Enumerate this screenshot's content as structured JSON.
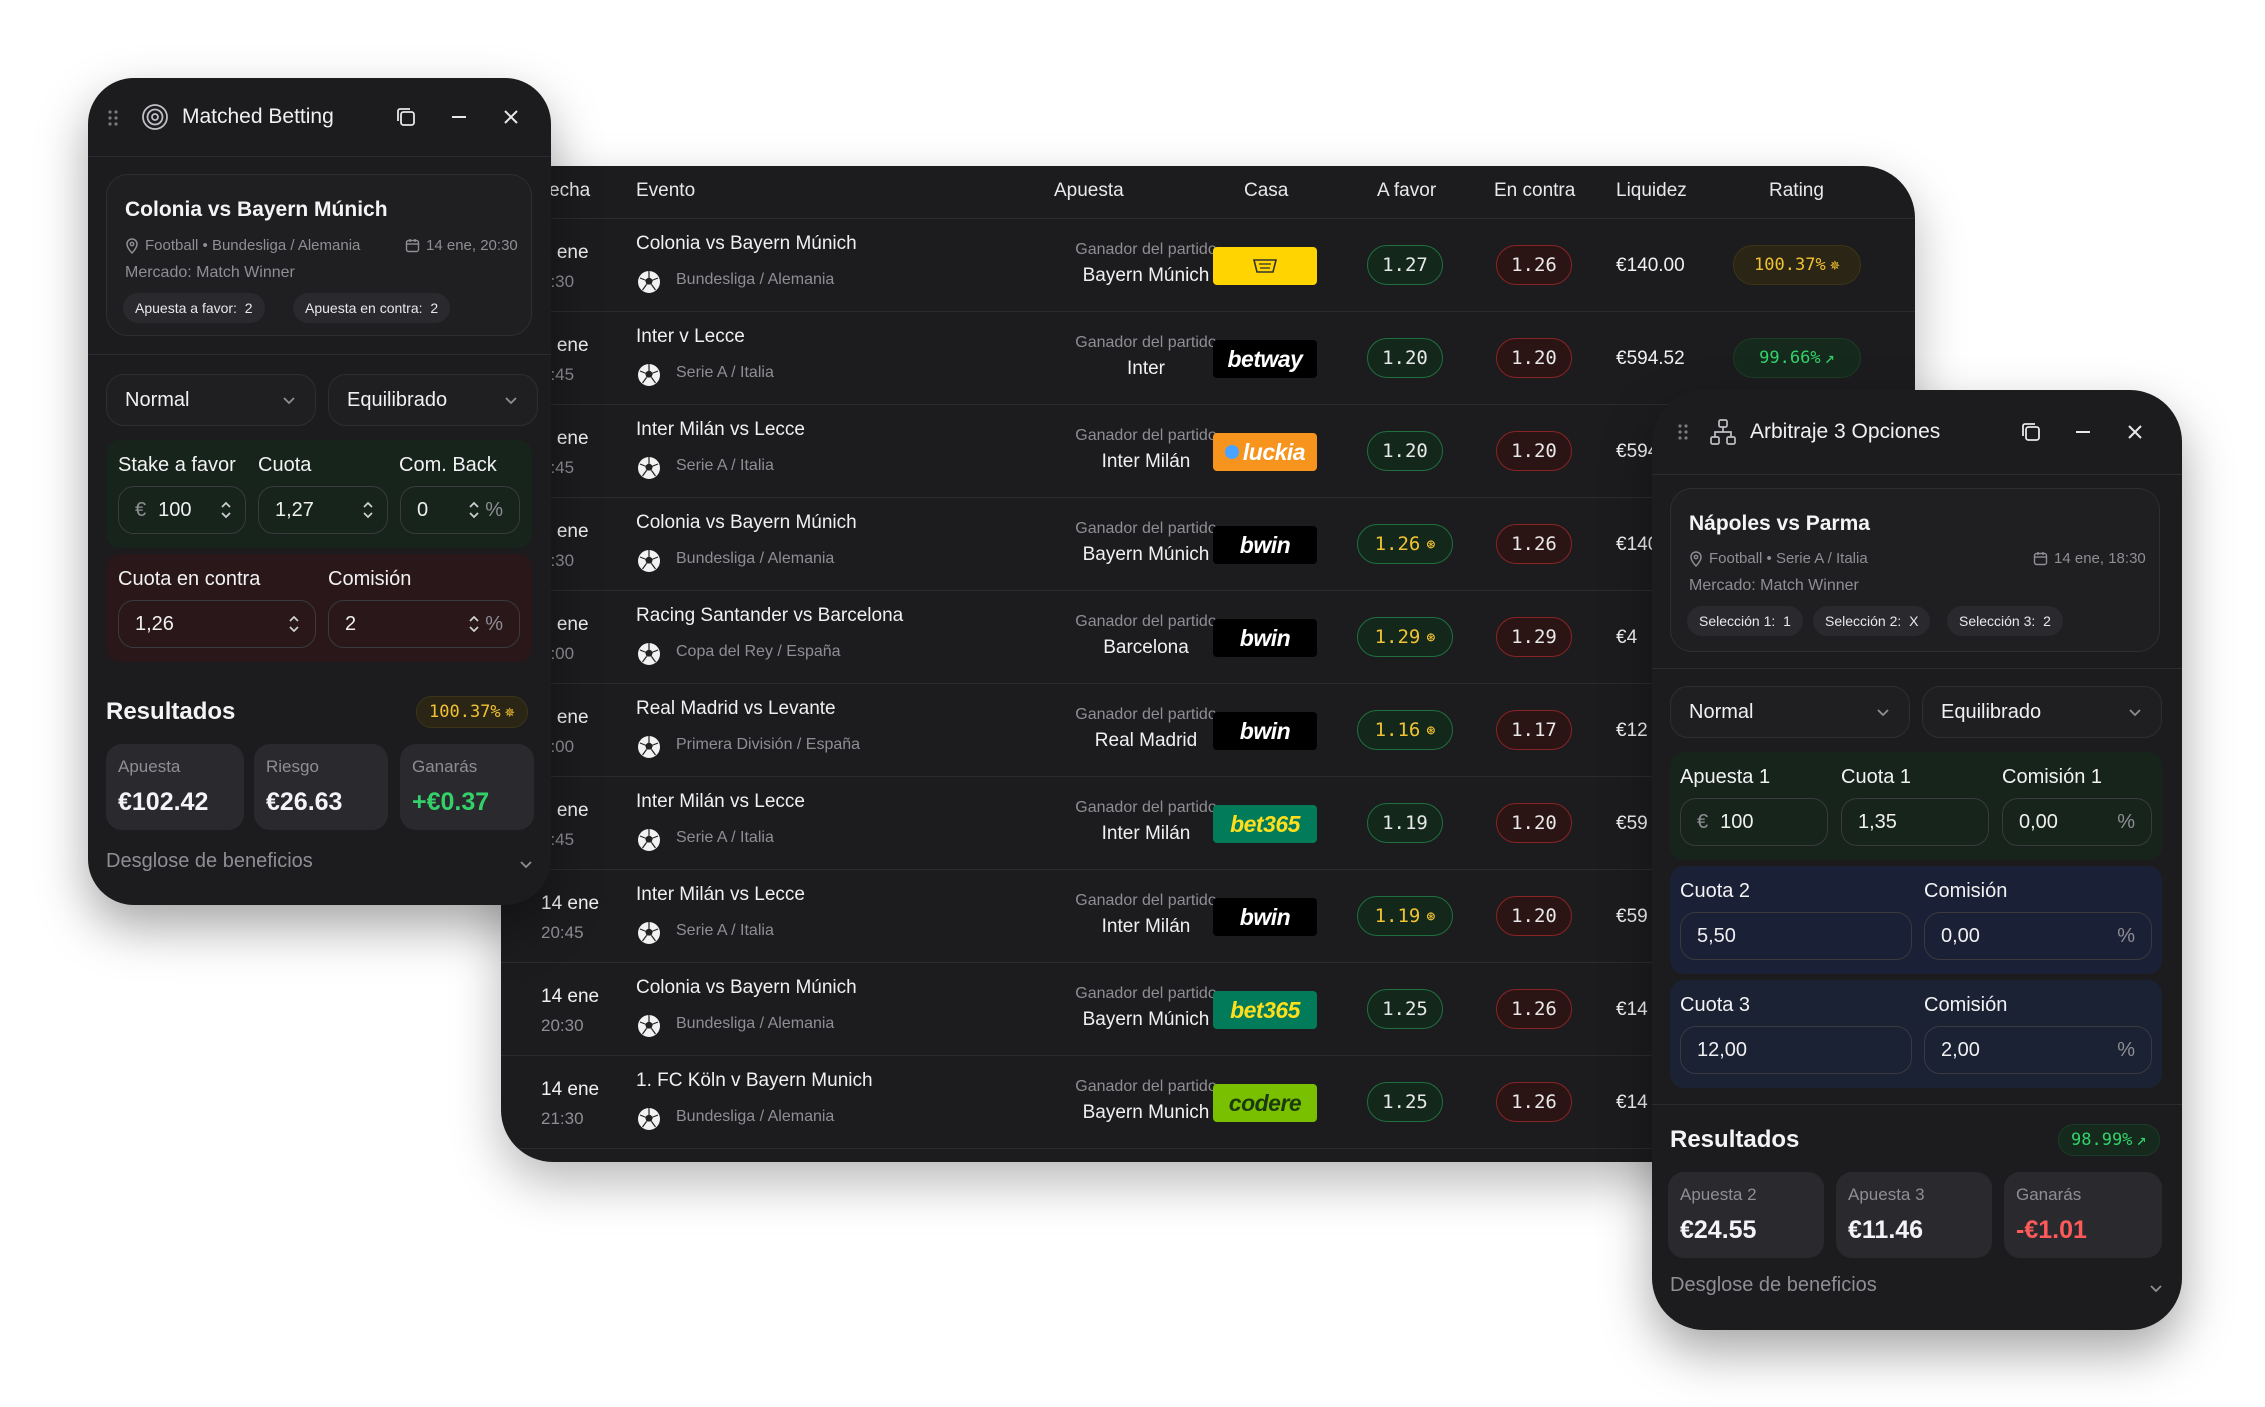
{
  "table": {
    "headers": {
      "date": "echa",
      "event": "Evento",
      "bet": "Apuesta",
      "house": "Casa",
      "back": "A favor",
      "lay": "En contra",
      "liquidity": "Liquidez",
      "rating": "Rating"
    },
    "rows": [
      {
        "date1": "4 ene",
        "date2": "0:30",
        "event": "Colonia vs Bayern Múnich",
        "league": "Bundesliga / Alemania",
        "bet_label": "Ganador del partido",
        "bet": "Bayern Múnich",
        "house": "interwetten",
        "back": "1.27",
        "lay": "1.26",
        "liquidity": "€140.00",
        "rating": "100.37%",
        "rating_icon": "sparkle-icon"
      },
      {
        "date1": "4 ene",
        "date2": "1:45",
        "event": "Inter v Lecce",
        "league": "Serie A / Italia",
        "bet_label": "Ganador del partido",
        "bet": "Inter",
        "house": "betway",
        "back": "1.20",
        "lay": "1.20",
        "liquidity": "€594.52",
        "rating": "99.66%",
        "rating_icon": "trend-up-icon"
      },
      {
        "date1": "4 ene",
        "date2": "0:45",
        "event": "Inter Milán vs Lecce",
        "league": "Serie A / Italia",
        "bet_label": "Ganador del partido",
        "bet": "Inter Milán",
        "house": "luckia",
        "back": "1.20",
        "lay": "1.20",
        "liquidity": "€594"
      },
      {
        "date1": "4 ene",
        "date2": "0:30",
        "event": "Colonia vs Bayern Múnich",
        "league": "Bundesliga / Alemania",
        "bet_label": "Ganador del partido",
        "bet": "Bayern Múnich",
        "house": "bwin",
        "back": "1.26",
        "lay": "1.26",
        "liquidity": "€140"
      },
      {
        "date1": "5 ene",
        "date2": "1:00",
        "event": "Racing Santander vs Barcelona",
        "league": "Copa del Rey / España",
        "bet_label": "Ganador del partido",
        "bet": "Barcelona",
        "house": "bwin",
        "back": "1.29",
        "lay": "1.29",
        "liquidity": "€4"
      },
      {
        "date1": "7 ene",
        "date2": "1:00",
        "event": "Real Madrid vs Levante",
        "league": "Primera División / España",
        "bet_label": "Ganador del partido",
        "bet": "Real Madrid",
        "house": "bwin",
        "back": "1.16",
        "lay": "1.17",
        "liquidity": "€12"
      },
      {
        "date1": "4 ene",
        "date2": "0:45",
        "event": "Inter Milán vs Lecce",
        "league": "Serie A / Italia",
        "bet_label": "Ganador del partido",
        "bet": "Inter Milán",
        "house": "bet365",
        "back": "1.19",
        "lay": "1.20",
        "liquidity": "€59"
      },
      {
        "date1": "14 ene",
        "date2": "20:45",
        "event": "Inter Milán vs Lecce",
        "league": "Serie A / Italia",
        "bet_label": "Ganador del partido",
        "bet": "Inter Milán",
        "house": "bwin",
        "back": "1.19",
        "lay": "1.20",
        "liquidity": "€59"
      },
      {
        "date1": "14 ene",
        "date2": "20:30",
        "event": "Colonia vs Bayern Múnich",
        "league": "Bundesliga / Alemania",
        "bet_label": "Ganador del partido",
        "bet": "Bayern Múnich",
        "house": "bet365",
        "back": "1.25",
        "lay": "1.26",
        "liquidity": "€14"
      },
      {
        "date1": "14 ene",
        "date2": "21:30",
        "event": "1. FC Köln v Bayern Munich",
        "league": "Bundesliga / Alemania",
        "bet_label": "Ganador del partido",
        "bet": "Bayern Munich",
        "house": "codere",
        "back": "1.25",
        "lay": "1.26",
        "liquidity": "€14"
      }
    ]
  },
  "matched_betting": {
    "title": "Matched Betting",
    "event": {
      "name": "Colonia vs Bayern Múnich",
      "meta": "Football • Bundesliga / Alemania",
      "date": "14 ene, 20:30",
      "market": "Mercado: Match Winner",
      "chip_back": "Apuesta a favor:",
      "chip_back_val": "2",
      "chip_lay": "Apuesta en contra:",
      "chip_lay_val": "2"
    },
    "mode": "Normal",
    "strategy": "Equilibrado",
    "back": {
      "stake_label": "Stake a favor",
      "odds_label": "Cuota",
      "com_label": "Com. Back",
      "currency": "€",
      "stake": "100",
      "odds": "1,27",
      "com": "0",
      "percent": "%"
    },
    "lay": {
      "odds_label": "Cuota en contra",
      "com_label": "Comisión",
      "odds": "1,26",
      "com": "2",
      "percent": "%"
    },
    "results": {
      "title": "Resultados",
      "rating": "100.37%",
      "stake_label": "Apuesta",
      "stake": "€102.42",
      "risk_label": "Riesgo",
      "risk": "€26.63",
      "win_label": "Ganarás",
      "win": "+€0.37",
      "breakdown": "Desglose de beneficios"
    }
  },
  "arbitrage": {
    "title": "Arbitraje 3 Opciones",
    "event": {
      "name": "Nápoles vs Parma",
      "meta": "Football • Serie A / Italia",
      "date": "14 ene, 18:30",
      "market": "Mercado: Match Winner",
      "chip1": "Selección 1:",
      "chip1_val": "1",
      "chip2": "Selección 2:",
      "chip2_val": "X",
      "chip3": "Selección 3:",
      "chip3_val": "2"
    },
    "mode": "Normal",
    "strategy": "Equilibrado",
    "s1": {
      "stake_label": "Apuesta 1",
      "odds_label": "Cuota 1",
      "com_label": "Comisión 1",
      "currency": "€",
      "stake": "100",
      "odds": "1,35",
      "com": "0,00",
      "percent": "%"
    },
    "s2": {
      "odds_label": "Cuota 2",
      "com_label": "Comisión",
      "odds": "5,50",
      "com": "0,00",
      "percent": "%"
    },
    "s3": {
      "odds_label": "Cuota 3",
      "com_label": "Comisión",
      "odds": "12,00",
      "com": "2,00",
      "percent": "%"
    },
    "results": {
      "title": "Resultados",
      "rating": "98.99%",
      "a2_label": "Apuesta 2",
      "a2": "€24.55",
      "a3_label": "Apuesta 3",
      "a3": "€11.46",
      "win_label": "Ganarás",
      "win": "-€1.01",
      "breakdown": "Desglose de beneficios"
    }
  },
  "colors": {
    "panel": "#1c1c1f",
    "accent_gold": "#f1c232",
    "positive": "#34d16b",
    "negative": "#ff5a5a"
  }
}
